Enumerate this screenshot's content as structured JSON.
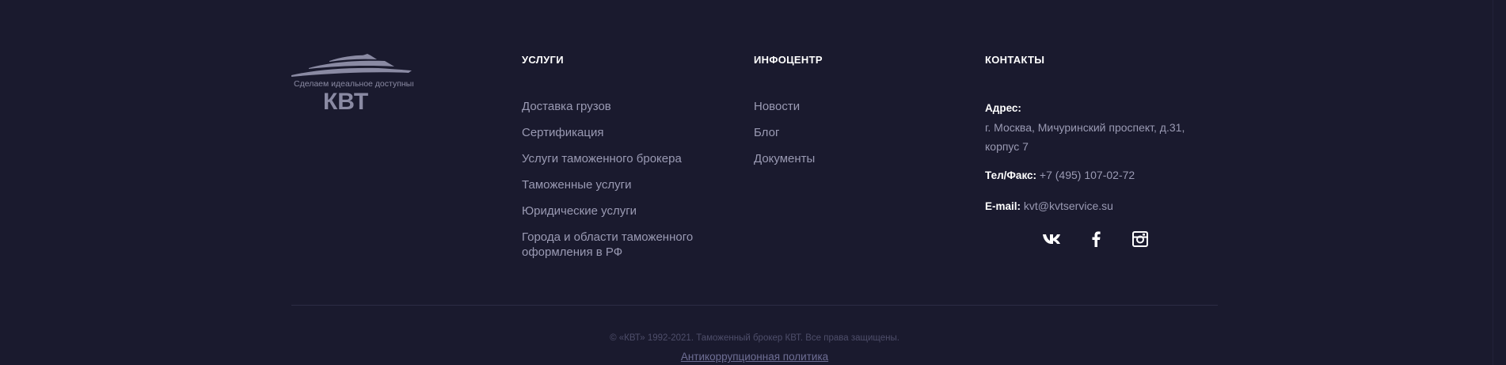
{
  "brand": {
    "slogan": "Сделаем идеальное доступным",
    "name": "КВТ"
  },
  "services": {
    "title": "УСЛУГИ",
    "items": [
      {
        "label": "Доставка грузов"
      },
      {
        "label": "Сертификация"
      },
      {
        "label": "Услуги таможенного брокера"
      },
      {
        "label": "Таможенные услуги"
      },
      {
        "label": "Юридические услуги"
      },
      {
        "label": "Города и области таможенного оформления в РФ"
      }
    ]
  },
  "infocenter": {
    "title": "ИНФОЦЕНТР",
    "items": [
      {
        "label": "Новости"
      },
      {
        "label": "Блог"
      },
      {
        "label": "Документы"
      }
    ]
  },
  "contacts": {
    "title": "КОНТАКТЫ",
    "address_label": "Адрес:",
    "address": "г. Москва, Мичуринский проспект, д.31, корпус 7",
    "phone_label": "Тел/Факс:",
    "phone": "+7 (495) 107-02-72",
    "email_label": "E-mail:",
    "email": "kvt@kvtservice.su",
    "socials": [
      {
        "icon": "vk-icon"
      },
      {
        "icon": "facebook-icon"
      },
      {
        "icon": "instagram-icon"
      }
    ]
  },
  "bottom": {
    "copyright": "© «КВТ» 1992-2021. Таможенный брокер КВТ. Все права защищены.",
    "anticorruption": "Антикоррупционная политика"
  },
  "colors": {
    "background": "#1a1a2e",
    "link": "#9a9ab3",
    "heading": "#ffffff",
    "muted": "#4e4e6a"
  }
}
